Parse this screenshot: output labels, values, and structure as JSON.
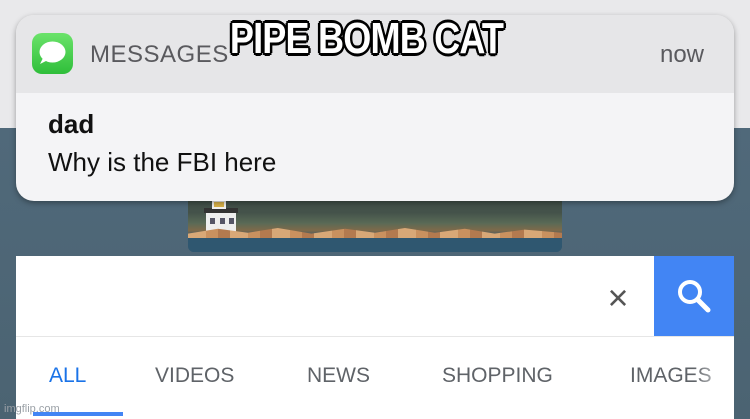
{
  "notification": {
    "app_name": "MESSAGES",
    "time": "now",
    "sender": "dad",
    "message": "Why is the FBI here"
  },
  "search": {
    "query": "PIPE BOMB CAT",
    "clear_label": "×"
  },
  "tabs": [
    {
      "label": "ALL",
      "active": true
    },
    {
      "label": "VIDEOS",
      "active": false
    },
    {
      "label": "NEWS",
      "active": false
    },
    {
      "label": "SHOPPING",
      "active": false
    },
    {
      "label": "IMAGES",
      "active": false
    }
  ],
  "watermark": "imgflip.com",
  "colors": {
    "accent_blue": "#4285f4",
    "active_tab": "#1a73e8",
    "messages_green": "#34c759",
    "background": "#4d6675"
  },
  "icons": {
    "app": "messages-bubble-icon",
    "search": "magnifier-icon",
    "clear": "close-icon"
  }
}
